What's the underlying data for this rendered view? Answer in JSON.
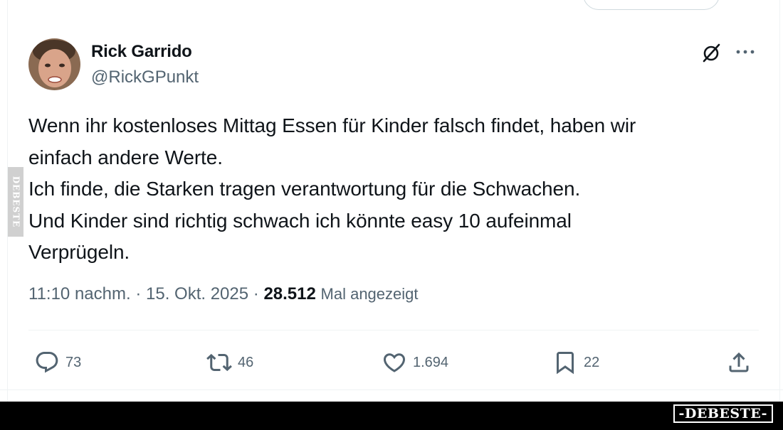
{
  "tweet": {
    "author": {
      "display_name": "Rick Garrido",
      "handle": "@RickGPunkt",
      "avatar": "profile-photo"
    },
    "body_lines": [
      "Wenn ihr kostenloses Mittag Essen für Kinder falsch findet, haben wir",
      "einfach andere Werte.",
      "Ich finde, die Starken tragen verantwortung für die Schwachen.",
      "Und Kinder sind richtig schwach ich könnte easy 10 aufeinmal",
      "Verprügeln."
    ],
    "meta": {
      "time": "11:10 nachm.",
      "separator": "·",
      "date": "15. Okt. 2025",
      "views_count": "28.512",
      "views_label": "Mal angezeigt"
    },
    "actions": {
      "replies": "73",
      "reposts": "46",
      "likes": "1.694",
      "bookmarks": "22"
    },
    "icons": {
      "grok": "grok-icon",
      "more": "more-icon",
      "reply": "reply-icon",
      "repost": "repost-icon",
      "like": "heart-icon",
      "bookmark": "bookmark-icon",
      "share": "share-icon"
    }
  },
  "watermark": {
    "side_text": "DEBESTE",
    "bottom_logo": "-DEBESTE-"
  },
  "colors": {
    "text_primary": "#0f1419",
    "text_secondary": "#536471",
    "divider": "#eff3f4",
    "bottom_bar": "#000000"
  }
}
